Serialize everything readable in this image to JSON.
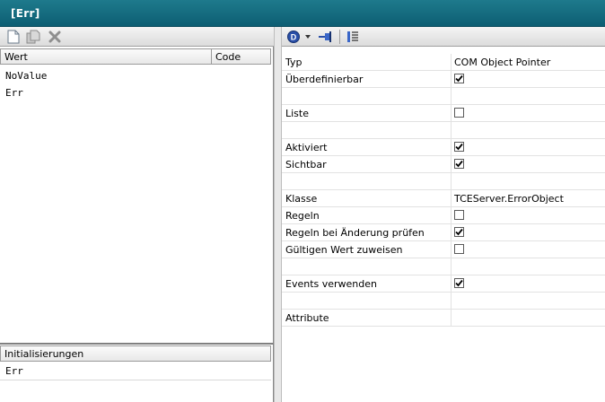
{
  "window": {
    "title": "[Err]"
  },
  "left_toolbar": {
    "icons": [
      "new-document-icon",
      "copy-icon",
      "delete-icon"
    ]
  },
  "value_list": {
    "columns": [
      "Wert",
      "Code"
    ],
    "items": [
      "NoValue",
      "Err"
    ]
  },
  "initializations": {
    "header": "Initialisierungen",
    "items": [
      "Err"
    ]
  },
  "right_toolbar": {
    "icons": [
      "info-dropdown-icon",
      "pin-icon",
      "property-list-icon"
    ]
  },
  "properties": [
    {
      "name": "Typ",
      "value": "COM Object Pointer"
    },
    {
      "name": "Überdefinierbar",
      "checkbox": true,
      "checked": true
    },
    {
      "name": "",
      "value": ""
    },
    {
      "name": "Liste",
      "checkbox": true,
      "checked": false
    },
    {
      "name": "",
      "value": ""
    },
    {
      "name": "Aktiviert",
      "checkbox": true,
      "checked": true
    },
    {
      "name": "Sichtbar",
      "checkbox": true,
      "checked": true
    },
    {
      "name": "",
      "value": ""
    },
    {
      "name": "Klasse",
      "value": "TCEServer.ErrorObject"
    },
    {
      "name": "Regeln",
      "checkbox": true,
      "checked": false
    },
    {
      "name": "Regeln bei Änderung prüfen",
      "checkbox": true,
      "checked": true
    },
    {
      "name": "Gültigen Wert zuweisen",
      "checkbox": true,
      "checked": false
    },
    {
      "name": "",
      "value": ""
    },
    {
      "name": "Events verwenden",
      "checkbox": true,
      "checked": true
    },
    {
      "name": "",
      "value": ""
    },
    {
      "name": "Attribute",
      "value": ""
    }
  ],
  "colors": {
    "titlebar": "#0d5e73",
    "titlebar_text": "#ffffff"
  }
}
